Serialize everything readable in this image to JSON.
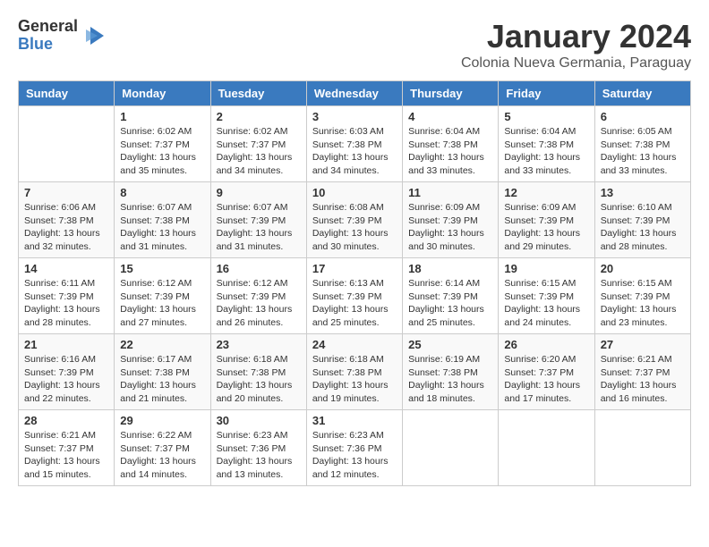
{
  "logo": {
    "general": "General",
    "blue": "Blue"
  },
  "title": "January 2024",
  "subtitle": "Colonia Nueva Germania, Paraguay",
  "days_of_week": [
    "Sunday",
    "Monday",
    "Tuesday",
    "Wednesday",
    "Thursday",
    "Friday",
    "Saturday"
  ],
  "weeks": [
    [
      {
        "day": "",
        "sunrise": "",
        "sunset": "",
        "daylight": ""
      },
      {
        "day": "1",
        "sunrise": "Sunrise: 6:02 AM",
        "sunset": "Sunset: 7:37 PM",
        "daylight": "Daylight: 13 hours and 35 minutes."
      },
      {
        "day": "2",
        "sunrise": "Sunrise: 6:02 AM",
        "sunset": "Sunset: 7:37 PM",
        "daylight": "Daylight: 13 hours and 34 minutes."
      },
      {
        "day": "3",
        "sunrise": "Sunrise: 6:03 AM",
        "sunset": "Sunset: 7:38 PM",
        "daylight": "Daylight: 13 hours and 34 minutes."
      },
      {
        "day": "4",
        "sunrise": "Sunrise: 6:04 AM",
        "sunset": "Sunset: 7:38 PM",
        "daylight": "Daylight: 13 hours and 33 minutes."
      },
      {
        "day": "5",
        "sunrise": "Sunrise: 6:04 AM",
        "sunset": "Sunset: 7:38 PM",
        "daylight": "Daylight: 13 hours and 33 minutes."
      },
      {
        "day": "6",
        "sunrise": "Sunrise: 6:05 AM",
        "sunset": "Sunset: 7:38 PM",
        "daylight": "Daylight: 13 hours and 33 minutes."
      }
    ],
    [
      {
        "day": "7",
        "sunrise": "Sunrise: 6:06 AM",
        "sunset": "Sunset: 7:38 PM",
        "daylight": "Daylight: 13 hours and 32 minutes."
      },
      {
        "day": "8",
        "sunrise": "Sunrise: 6:07 AM",
        "sunset": "Sunset: 7:38 PM",
        "daylight": "Daylight: 13 hours and 31 minutes."
      },
      {
        "day": "9",
        "sunrise": "Sunrise: 6:07 AM",
        "sunset": "Sunset: 7:39 PM",
        "daylight": "Daylight: 13 hours and 31 minutes."
      },
      {
        "day": "10",
        "sunrise": "Sunrise: 6:08 AM",
        "sunset": "Sunset: 7:39 PM",
        "daylight": "Daylight: 13 hours and 30 minutes."
      },
      {
        "day": "11",
        "sunrise": "Sunrise: 6:09 AM",
        "sunset": "Sunset: 7:39 PM",
        "daylight": "Daylight: 13 hours and 30 minutes."
      },
      {
        "day": "12",
        "sunrise": "Sunrise: 6:09 AM",
        "sunset": "Sunset: 7:39 PM",
        "daylight": "Daylight: 13 hours and 29 minutes."
      },
      {
        "day": "13",
        "sunrise": "Sunrise: 6:10 AM",
        "sunset": "Sunset: 7:39 PM",
        "daylight": "Daylight: 13 hours and 28 minutes."
      }
    ],
    [
      {
        "day": "14",
        "sunrise": "Sunrise: 6:11 AM",
        "sunset": "Sunset: 7:39 PM",
        "daylight": "Daylight: 13 hours and 28 minutes."
      },
      {
        "day": "15",
        "sunrise": "Sunrise: 6:12 AM",
        "sunset": "Sunset: 7:39 PM",
        "daylight": "Daylight: 13 hours and 27 minutes."
      },
      {
        "day": "16",
        "sunrise": "Sunrise: 6:12 AM",
        "sunset": "Sunset: 7:39 PM",
        "daylight": "Daylight: 13 hours and 26 minutes."
      },
      {
        "day": "17",
        "sunrise": "Sunrise: 6:13 AM",
        "sunset": "Sunset: 7:39 PM",
        "daylight": "Daylight: 13 hours and 25 minutes."
      },
      {
        "day": "18",
        "sunrise": "Sunrise: 6:14 AM",
        "sunset": "Sunset: 7:39 PM",
        "daylight": "Daylight: 13 hours and 25 minutes."
      },
      {
        "day": "19",
        "sunrise": "Sunrise: 6:15 AM",
        "sunset": "Sunset: 7:39 PM",
        "daylight": "Daylight: 13 hours and 24 minutes."
      },
      {
        "day": "20",
        "sunrise": "Sunrise: 6:15 AM",
        "sunset": "Sunset: 7:39 PM",
        "daylight": "Daylight: 13 hours and 23 minutes."
      }
    ],
    [
      {
        "day": "21",
        "sunrise": "Sunrise: 6:16 AM",
        "sunset": "Sunset: 7:39 PM",
        "daylight": "Daylight: 13 hours and 22 minutes."
      },
      {
        "day": "22",
        "sunrise": "Sunrise: 6:17 AM",
        "sunset": "Sunset: 7:38 PM",
        "daylight": "Daylight: 13 hours and 21 minutes."
      },
      {
        "day": "23",
        "sunrise": "Sunrise: 6:18 AM",
        "sunset": "Sunset: 7:38 PM",
        "daylight": "Daylight: 13 hours and 20 minutes."
      },
      {
        "day": "24",
        "sunrise": "Sunrise: 6:18 AM",
        "sunset": "Sunset: 7:38 PM",
        "daylight": "Daylight: 13 hours and 19 minutes."
      },
      {
        "day": "25",
        "sunrise": "Sunrise: 6:19 AM",
        "sunset": "Sunset: 7:38 PM",
        "daylight": "Daylight: 13 hours and 18 minutes."
      },
      {
        "day": "26",
        "sunrise": "Sunrise: 6:20 AM",
        "sunset": "Sunset: 7:37 PM",
        "daylight": "Daylight: 13 hours and 17 minutes."
      },
      {
        "day": "27",
        "sunrise": "Sunrise: 6:21 AM",
        "sunset": "Sunset: 7:37 PM",
        "daylight": "Daylight: 13 hours and 16 minutes."
      }
    ],
    [
      {
        "day": "28",
        "sunrise": "Sunrise: 6:21 AM",
        "sunset": "Sunset: 7:37 PM",
        "daylight": "Daylight: 13 hours and 15 minutes."
      },
      {
        "day": "29",
        "sunrise": "Sunrise: 6:22 AM",
        "sunset": "Sunset: 7:37 PM",
        "daylight": "Daylight: 13 hours and 14 minutes."
      },
      {
        "day": "30",
        "sunrise": "Sunrise: 6:23 AM",
        "sunset": "Sunset: 7:36 PM",
        "daylight": "Daylight: 13 hours and 13 minutes."
      },
      {
        "day": "31",
        "sunrise": "Sunrise: 6:23 AM",
        "sunset": "Sunset: 7:36 PM",
        "daylight": "Daylight: 13 hours and 12 minutes."
      },
      {
        "day": "",
        "sunrise": "",
        "sunset": "",
        "daylight": ""
      },
      {
        "day": "",
        "sunrise": "",
        "sunset": "",
        "daylight": ""
      },
      {
        "day": "",
        "sunrise": "",
        "sunset": "",
        "daylight": ""
      }
    ]
  ]
}
